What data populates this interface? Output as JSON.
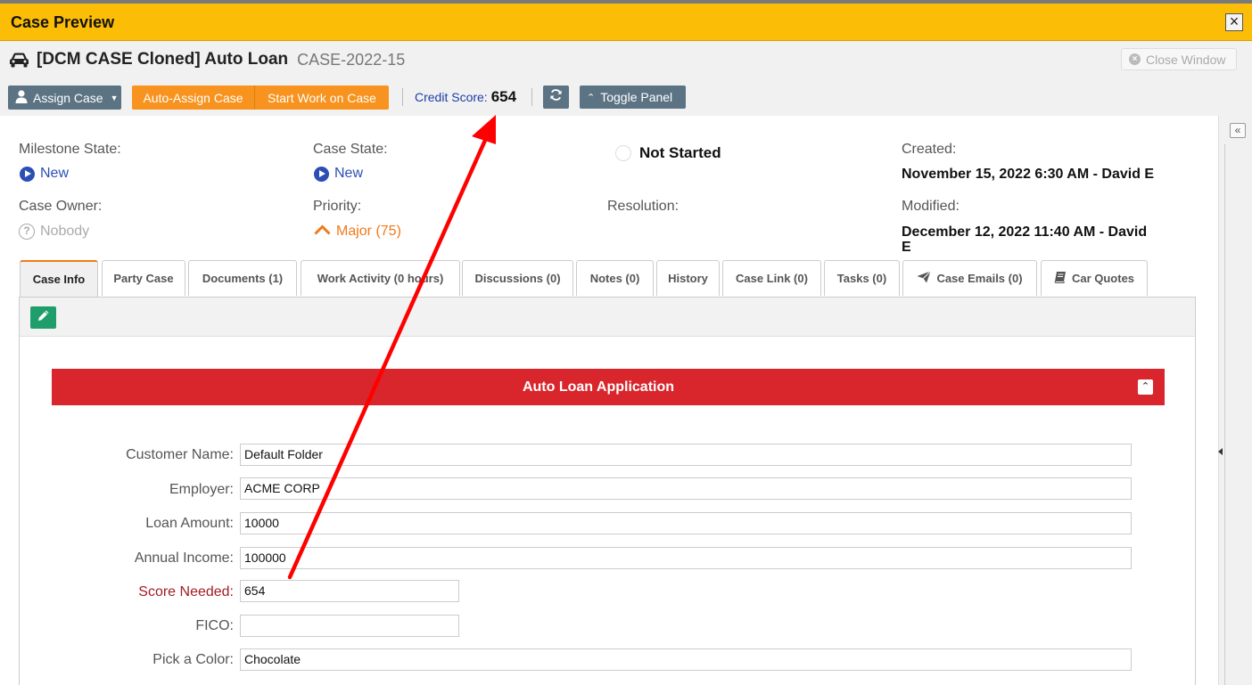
{
  "window": {
    "title": "Case Preview",
    "close_glyph": "×"
  },
  "case": {
    "name": "[DCM CASE Cloned] Auto Loan",
    "id": "CASE-2022-15",
    "icon": "car-icon"
  },
  "close_window_label": "Close Window",
  "toolbar": {
    "assign_label": "Assign Case",
    "auto_assign_label": "Auto-Assign Case",
    "start_work_label": "Start Work on Case",
    "credit_label": "Credit Score:",
    "credit_value": "654",
    "toggle_label": "Toggle Panel"
  },
  "summary": {
    "milestone_label": "Milestone State:",
    "milestone_value": "New",
    "case_state_label": "Case State:",
    "case_state_value": "New",
    "status": "Not Started",
    "created_label": "Created:",
    "created_value": "November 15, 2022 6:30 AM - David E",
    "owner_label": "Case Owner:",
    "owner_value": "Nobody",
    "priority_label": "Priority:",
    "priority_value": "Major (75)",
    "resolution_label": "Resolution:",
    "modified_label": "Modified:",
    "modified_value_line1": "December 12, 2022 11:40 AM - David",
    "modified_value_line2": "E"
  },
  "tabs": [
    {
      "label": "Case Info",
      "active": true
    },
    {
      "label": "Party Case"
    },
    {
      "label": "Documents (1)"
    },
    {
      "label": "Work Activity (0 hours)"
    },
    {
      "label": "Discussions (0)"
    },
    {
      "label": "Notes (0)"
    },
    {
      "label": "History"
    },
    {
      "label": "Case Link (0)"
    },
    {
      "label": "Tasks (0)"
    },
    {
      "label": "Case Emails (0)",
      "icon": "paper-plane-icon"
    },
    {
      "label": "Car Quotes",
      "icon": "book-icon"
    }
  ],
  "section": {
    "title": "Auto Loan Application"
  },
  "form": {
    "customer_name": {
      "label": "Customer Name:",
      "value": "Default Folder"
    },
    "employer": {
      "label": "Employer:",
      "value": "ACME CORP"
    },
    "loan_amount": {
      "label": "Loan Amount:",
      "value": "10000"
    },
    "annual_income": {
      "label": "Annual Income:",
      "value": "100000"
    },
    "score_needed": {
      "label": "Score Needed:",
      "value": "654"
    },
    "fico": {
      "label": "FICO:",
      "value": ""
    },
    "pick_color": {
      "label": "Pick a Color:",
      "value": "Chocolate"
    }
  },
  "colors": {
    "title_bar": "#fbbd05",
    "orange": "#f7931e",
    "slate": "#5b7383",
    "section_red": "#d9262c",
    "annotation_arrow": "#ff0000"
  }
}
